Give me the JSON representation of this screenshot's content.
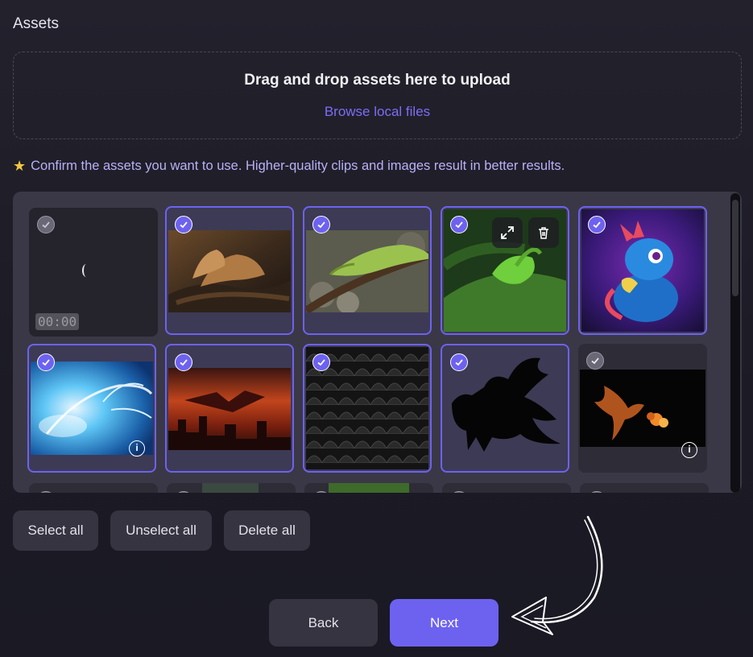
{
  "section_title": "Assets",
  "dropzone": {
    "title": "Drag and drop assets here to upload",
    "browse_link": "Browse local files"
  },
  "hint": {
    "icon": "star-icon",
    "text": "Confirm the assets you want to use. Higher-quality clips and images result in better results."
  },
  "assets": [
    {
      "kind": "video",
      "selected": false,
      "duration": "00:00"
    },
    {
      "kind": "image",
      "subject": "bearded dragon on log",
      "selected": true
    },
    {
      "kind": "image",
      "subject": "green iguana on branch",
      "selected": true
    },
    {
      "kind": "image",
      "subject": "green lizard on leaf",
      "selected": true,
      "hover_actions": [
        "expand-icon",
        "trash-icon"
      ]
    },
    {
      "kind": "image",
      "subject": "cute blue baby dragon",
      "selected": true
    },
    {
      "kind": "image",
      "subject": "blue ice dragon in sky",
      "selected": true,
      "info": true
    },
    {
      "kind": "image",
      "subject": "dragon over burning city",
      "selected": true
    },
    {
      "kind": "image",
      "subject": "black dragon scales",
      "selected": true
    },
    {
      "kind": "image",
      "subject": "black dragon silhouette",
      "selected": true
    },
    {
      "kind": "image",
      "subject": "orange dragon breathing fire",
      "selected": false,
      "info": true
    }
  ],
  "actions": {
    "select_all": "Select all",
    "unselect_all": "Unselect all",
    "delete_all": "Delete all"
  },
  "nav": {
    "back": "Back",
    "next": "Next"
  },
  "colors": {
    "accent": "#6d62f0",
    "link": "#7b6ef6",
    "hint_text": "#b7b1f7"
  }
}
